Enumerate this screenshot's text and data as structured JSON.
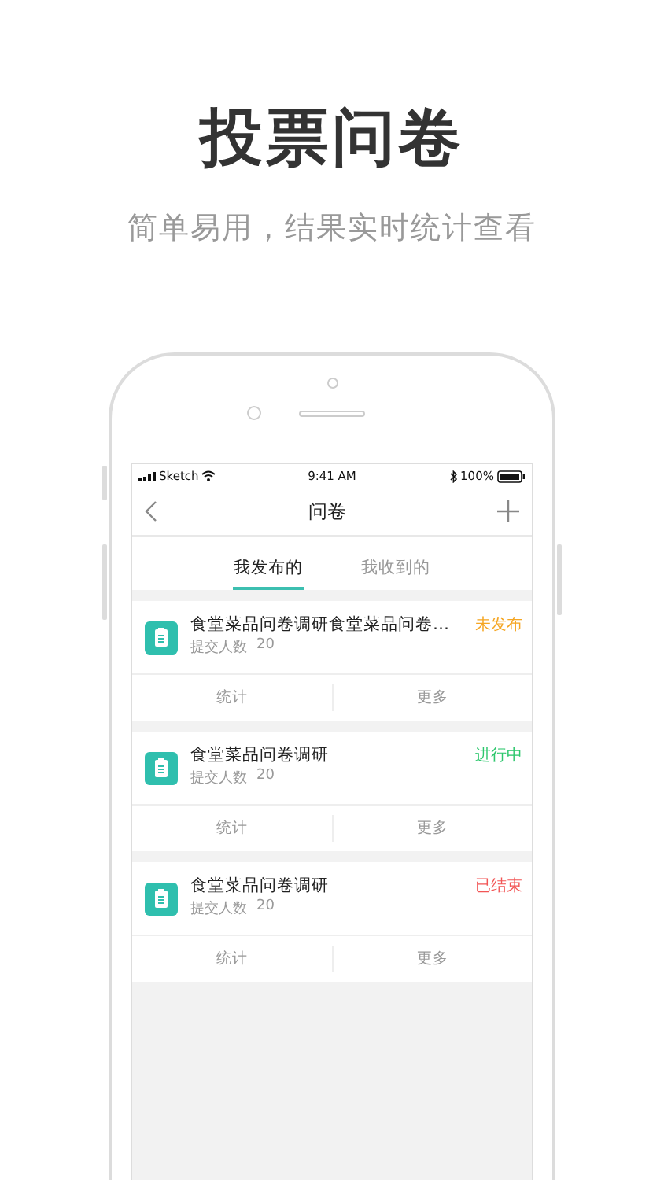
{
  "headline": "投票问卷",
  "subtitle": "简单易用，结果实时统计查看",
  "status_bar": {
    "carrier": "Sketch",
    "time": "9:41 AM",
    "battery": "100%"
  },
  "nav": {
    "title": "问卷"
  },
  "tabs": [
    {
      "label": "我发布的",
      "selected": true
    },
    {
      "label": "我收到的",
      "selected": false
    }
  ],
  "surveys": [
    {
      "title": "食堂菜品问卷调研食堂菜品问卷…",
      "count_label": "提交人数",
      "count": "20",
      "status": "未发布",
      "color": "#f5a623",
      "actions": [
        "统计",
        "更多"
      ]
    },
    {
      "title": "食堂菜品问卷调研",
      "count_label": "提交人数",
      "count": "20",
      "status": "进行中",
      "color": "#2dc76d",
      "actions": [
        "统计",
        "更多"
      ]
    },
    {
      "title": "食堂菜品问卷调研",
      "count_label": "提交人数",
      "count": "20",
      "status": "已结束",
      "color": "#f25656",
      "actions": [
        "统计",
        "更多"
      ]
    }
  ]
}
